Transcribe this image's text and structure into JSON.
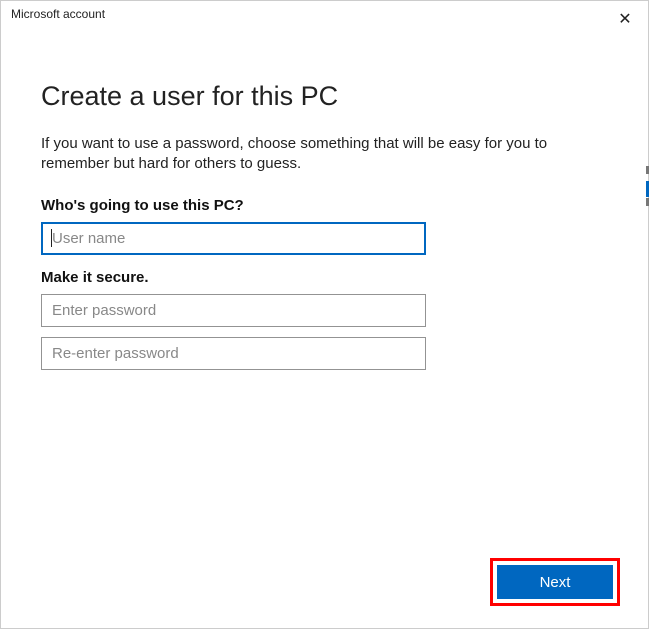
{
  "window": {
    "title": "Microsoft account"
  },
  "main": {
    "heading": "Create a user for this PC",
    "subtitle": "If you want to use a password, choose something that will be easy for you to remember but hard for others to guess.",
    "section_user_label": "Who's going to use this PC?",
    "section_password_label": "Make it secure.",
    "username_placeholder": "User name",
    "password_placeholder": "Enter password",
    "reenter_placeholder": "Re-enter password",
    "username_value": "",
    "password_value": "",
    "reenter_value": ""
  },
  "footer": {
    "next_label": "Next"
  }
}
